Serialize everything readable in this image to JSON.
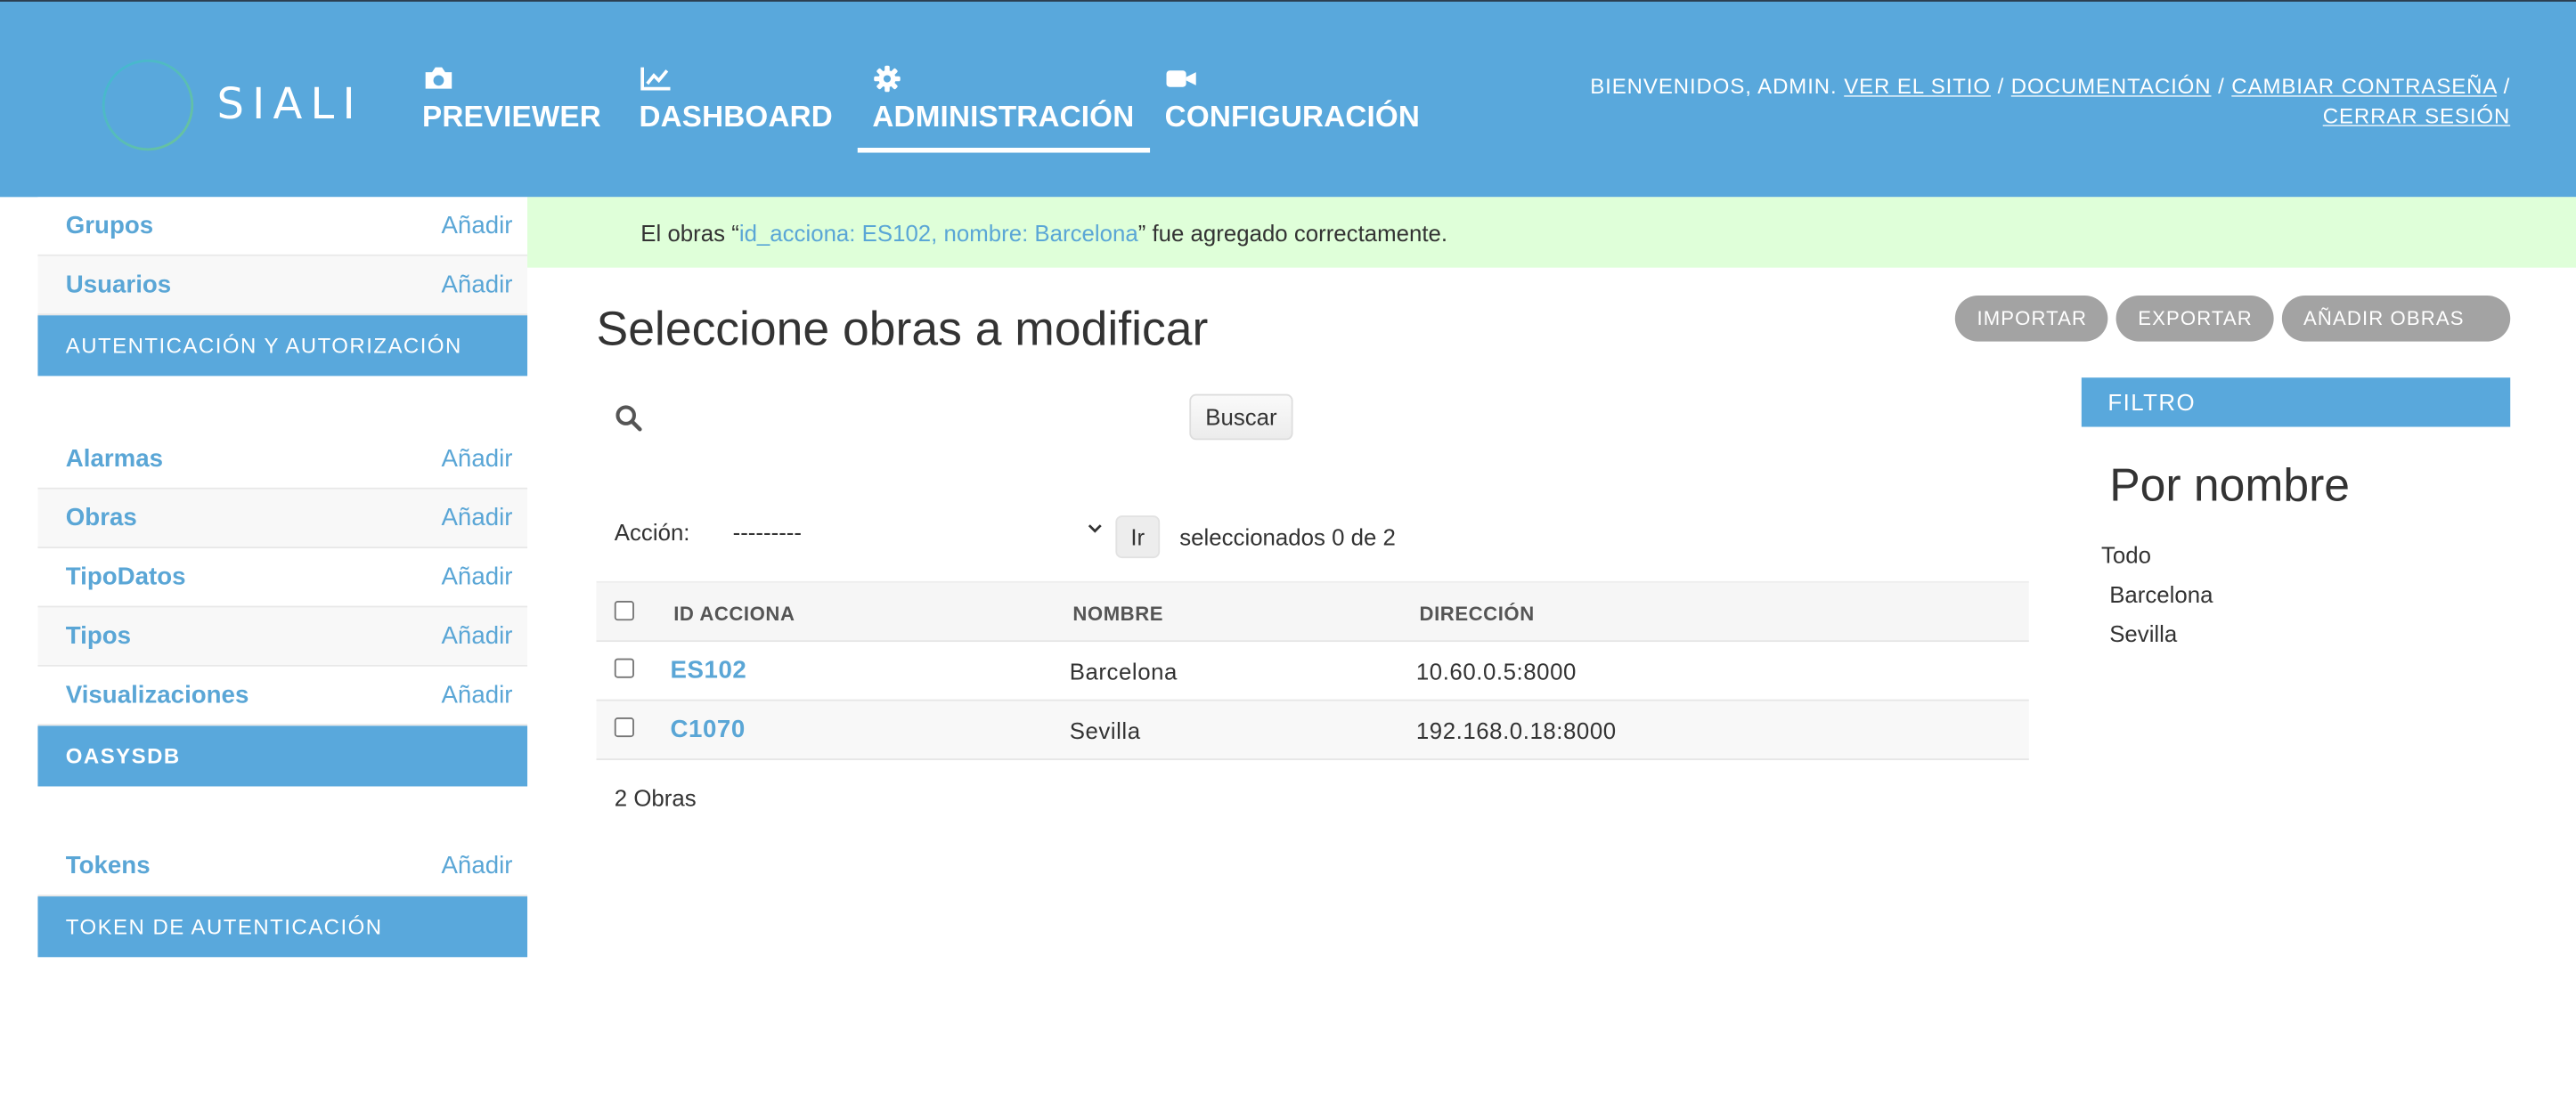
{
  "header": {
    "logo_text": "SIALI",
    "nav": [
      {
        "label": "PREVIEWER",
        "icon": "camera-icon"
      },
      {
        "label": "DASHBOARD",
        "icon": "line-chart-icon"
      },
      {
        "label": "ADMINISTRACIÓN",
        "icon": "gear-icon",
        "active": true
      },
      {
        "label": "CONFIGURACIÓN",
        "icon": "video-camera-icon"
      }
    ],
    "user_tools": {
      "welcome": "BIENVENIDOS,",
      "user": "ADMIN.",
      "view_site": "VER EL SITIO",
      "docs": "DOCUMENTACIÓN",
      "change_password": "CAMBIAR CONTRASEÑA",
      "logout": "CERRAR SESIÓN",
      "separator": "/"
    }
  },
  "sidebar": {
    "modules": [
      {
        "caption": "AUTENTICACIÓN Y AUTORIZACIÓN",
        "models": [
          {
            "name": "Grupos",
            "add": "Añadir"
          },
          {
            "name": "Usuarios",
            "add": "Añadir"
          }
        ]
      },
      {
        "caption": "OASYSDB",
        "models": [
          {
            "name": "Alarmas",
            "add": "Añadir"
          },
          {
            "name": "Obras",
            "add": "Añadir"
          },
          {
            "name": "TipoDatos",
            "add": "Añadir"
          },
          {
            "name": "Tipos",
            "add": "Añadir"
          },
          {
            "name": "Visualizaciones",
            "add": "Añadir"
          }
        ]
      },
      {
        "caption": "TOKEN DE AUTENTICACIÓN",
        "models": [
          {
            "name": "Tokens",
            "add": "Añadir"
          }
        ]
      }
    ]
  },
  "message": {
    "prefix": "El obras “",
    "link": "id_acciona: ES102, nombre: Barcelona",
    "suffix": "” fue agregado correctamente."
  },
  "content": {
    "title": "Seleccione obras a modificar",
    "object_tools": [
      "IMPORTAR",
      "EXPORTAR",
      "AÑADIR OBRAS"
    ],
    "search": {
      "value": "",
      "placeholder": "",
      "button": "Buscar"
    },
    "actions": {
      "label": "Acción:",
      "selected": "---------",
      "go": "Ir",
      "counter": "seleccionados 0 de 2"
    },
    "table": {
      "columns": [
        "ID ACCIONA",
        "NOMBRE",
        "DIRECCIÓN"
      ],
      "rows": [
        [
          "ES102",
          "Barcelona",
          "10.60.0.5:8000"
        ],
        [
          "C1070",
          "Sevilla",
          "192.168.0.18:8000"
        ]
      ]
    },
    "paginator": "2 Obras"
  },
  "filter": {
    "caption": "FILTRO",
    "title": "Por nombre",
    "choices": [
      "Todo",
      "Barcelona",
      "Sevilla"
    ]
  },
  "colors": {
    "header_bg": "#59a8dc",
    "link": "#5aa6d6",
    "success_bg": "#dfffd9",
    "object_tool_bg": "#a3a3a3"
  }
}
